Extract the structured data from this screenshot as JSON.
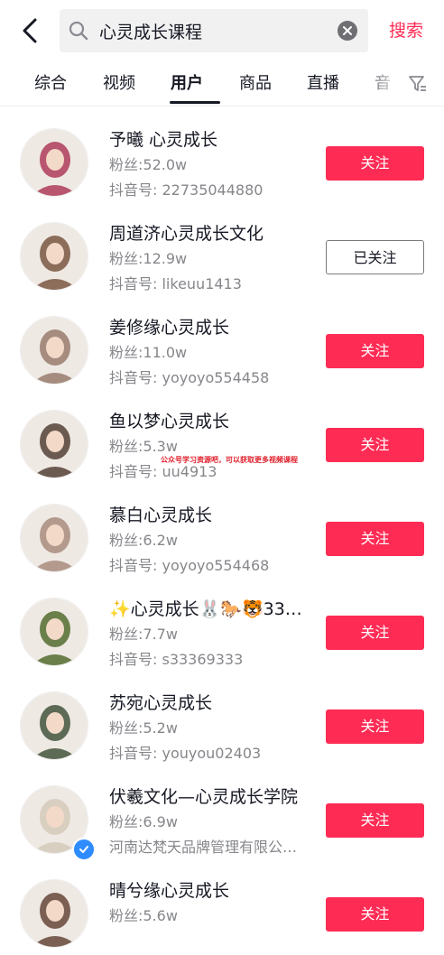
{
  "search": {
    "query": "心灵成长课程",
    "button_label": "搜索"
  },
  "tabs": [
    {
      "label": "综合"
    },
    {
      "label": "视频"
    },
    {
      "label": "用户"
    },
    {
      "label": "商品"
    },
    {
      "label": "直播"
    },
    {
      "label": "音"
    }
  ],
  "active_tab": "用户",
  "users": [
    {
      "name": "予曦 心灵成长",
      "fans": "粉丝:52.0w",
      "id": "抖音号: 22735044880",
      "button": "关注",
      "followed": false,
      "avatar_color": "#b8556f",
      "verified": false
    },
    {
      "name": "周道济心灵成长文化",
      "fans": "粉丝:12.9w",
      "id": "抖音号: likeuu1413",
      "button": "已关注",
      "followed": true,
      "avatar_color": "#8b6d5a",
      "verified": false
    },
    {
      "name": "姜修缘心灵成长",
      "fans": "粉丝:11.0w",
      "id": "抖音号: yoyoyo554458",
      "button": "关注",
      "followed": false,
      "avatar_color": "#a58c7e",
      "verified": false
    },
    {
      "name": "鱼以梦心灵成长",
      "fans": "粉丝:5.3w",
      "id": "抖音号: uu4913",
      "button": "关注",
      "followed": false,
      "avatar_color": "#6b5a4f",
      "verified": false
    },
    {
      "name": "慕白心灵成长",
      "fans": "粉丝:6.2w",
      "id": "抖音号: yoyoyo554468",
      "button": "关注",
      "followed": false,
      "avatar_color": "#b39a8c",
      "verified": false
    },
    {
      "name": "✨心灵成长🐰🐎🐯33…",
      "fans": "粉丝:7.7w",
      "id": "抖音号: s33369333",
      "button": "关注",
      "followed": false,
      "avatar_color": "#6a7f4a",
      "verified": false
    },
    {
      "name": "苏宛心灵成长",
      "fans": "粉丝:5.2w",
      "id": "抖音号: youyou02403",
      "button": "关注",
      "followed": false,
      "avatar_color": "#5d6a55",
      "verified": false
    },
    {
      "name": "伏羲文化—心灵成长学院",
      "fans": "粉丝:6.9w",
      "id": "河南达梵天品牌管理有限公…",
      "button": "关注",
      "followed": false,
      "avatar_color": "#d9cfc0",
      "verified": true
    },
    {
      "name": "晴兮缘心灵成长",
      "fans": "粉丝:5.6w",
      "id": "",
      "button": "关注",
      "followed": false,
      "avatar_color": "#7a5f52",
      "verified": false
    }
  ],
  "watermark": "公众号学习资源吧，可以获取更多视频课程",
  "colors": {
    "accent": "#fe2c55",
    "verified": "#2f8cff"
  }
}
